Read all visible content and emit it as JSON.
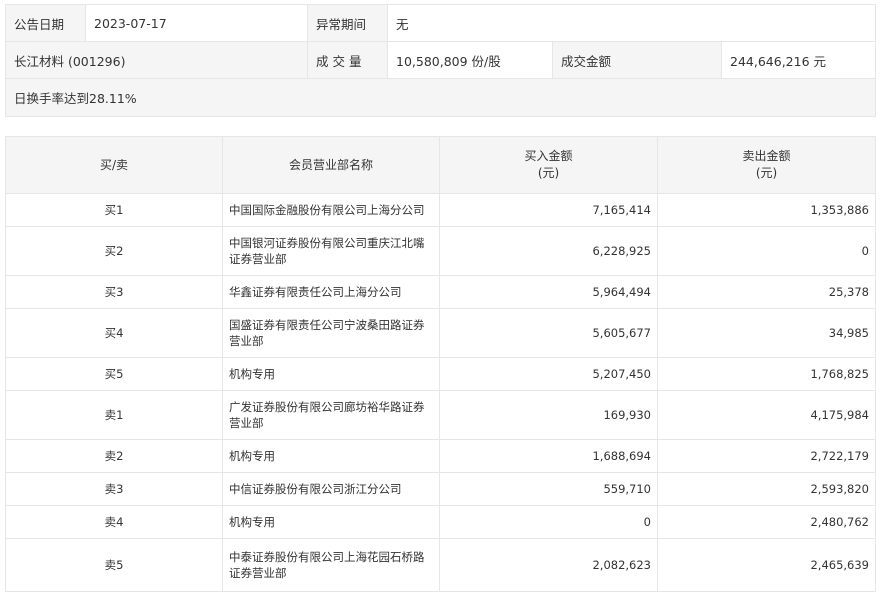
{
  "info": {
    "announce_date_label": "公告日期",
    "announce_date": "2023-07-17",
    "abnormal_period_label": "异常期间",
    "abnormal_period": "无",
    "stock": "长江材料 (001296)",
    "volume_label": "成 交 量",
    "volume": "10,580,809 份/股",
    "turnover_label": "成交金额",
    "turnover": "244,646,216 元",
    "reason": "日换手率达到28.11%"
  },
  "table": {
    "headers": {
      "side": "买/卖",
      "branch": "会员营业部名称",
      "buy_l1": "买入金额",
      "buy_l2": "(元)",
      "sell_l1": "卖出金额",
      "sell_l2": "(元)"
    },
    "rows": [
      {
        "side": "买1",
        "branch": "中国国际金融股份有限公司上海分公司",
        "buy": "7,165,414",
        "sell": "1,353,886"
      },
      {
        "side": "买2",
        "branch": "中国银河证券股份有限公司重庆江北嘴证券营业部",
        "buy": "6,228,925",
        "sell": "0"
      },
      {
        "side": "买3",
        "branch": "华鑫证券有限责任公司上海分公司",
        "buy": "5,964,494",
        "sell": "25,378"
      },
      {
        "side": "买4",
        "branch": "国盛证券有限责任公司宁波桑田路证券营业部",
        "buy": "5,605,677",
        "sell": "34,985"
      },
      {
        "side": "买5",
        "branch": "机构专用",
        "buy": "5,207,450",
        "sell": "1,768,825"
      },
      {
        "side": "卖1",
        "branch": "广发证券股份有限公司廊坊裕华路证券营业部",
        "buy": "169,930",
        "sell": "4,175,984"
      },
      {
        "side": "卖2",
        "branch": "机构专用",
        "buy": "1,688,694",
        "sell": "2,722,179"
      },
      {
        "side": "卖3",
        "branch": "中信证券股份有限公司浙江分公司",
        "buy": "559,710",
        "sell": "2,593,820"
      },
      {
        "side": "卖4",
        "branch": "机构专用",
        "buy": "0",
        "sell": "2,480,762"
      },
      {
        "side": "卖5",
        "branch": "中泰证券股份有限公司上海花园石桥路证券营业部",
        "buy": "2,082,623",
        "sell": "2,465,639"
      }
    ]
  }
}
